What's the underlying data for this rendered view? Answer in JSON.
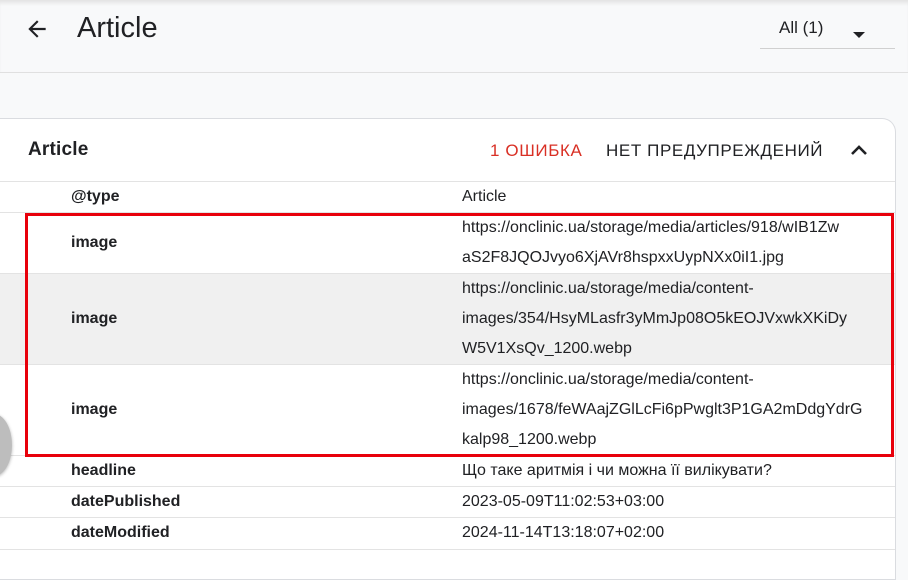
{
  "header": {
    "back_icon": "arrow-left-icon",
    "title": "Article",
    "filter_value": "All (1)",
    "filter_icon": "caret-down-icon"
  },
  "card": {
    "title": "Article",
    "errors": "1 ОШИБКА",
    "warnings": "НЕТ ПРЕДУПРЕЖДЕНИЙ",
    "collapse_icon": "chevron-up-icon",
    "error_color": "#d93025",
    "highlight_color": "#e8000b",
    "rows": [
      {
        "key": "@type",
        "value_lines": [
          "Article"
        ]
      },
      {
        "key": "image",
        "value_lines": [
          "https://onclinic.ua/storage/media/articles/918/wIB1Zw",
          "aS2F8JQOJvyo6XjAVr8hspxxUypNXx0iI1.jpg"
        ]
      },
      {
        "key": "image",
        "value_lines": [
          "https://onclinic.ua/storage/media/content-",
          "images/354/HsyMLasfr3yMmJp08O5kEOJVxwkXKiDy",
          "W5V1XsQv_1200.webp"
        ]
      },
      {
        "key": "image",
        "value_lines": [
          "https://onclinic.ua/storage/media/content-",
          "images/1678/feWAajZGlLcFi6pPwglt3P1GA2mDdgYdrG",
          "kalp98_1200.webp"
        ]
      },
      {
        "key": "headline",
        "value_lines": [
          "Що таке аритмія і чи можна її вилікувати?"
        ]
      },
      {
        "key": "datePublished",
        "value_lines": [
          "2023-05-09T11:02:53+03:00"
        ]
      },
      {
        "key": "dateModified",
        "value_lines": [
          "2024-11-14T13:18:07+02:00"
        ]
      }
    ]
  }
}
